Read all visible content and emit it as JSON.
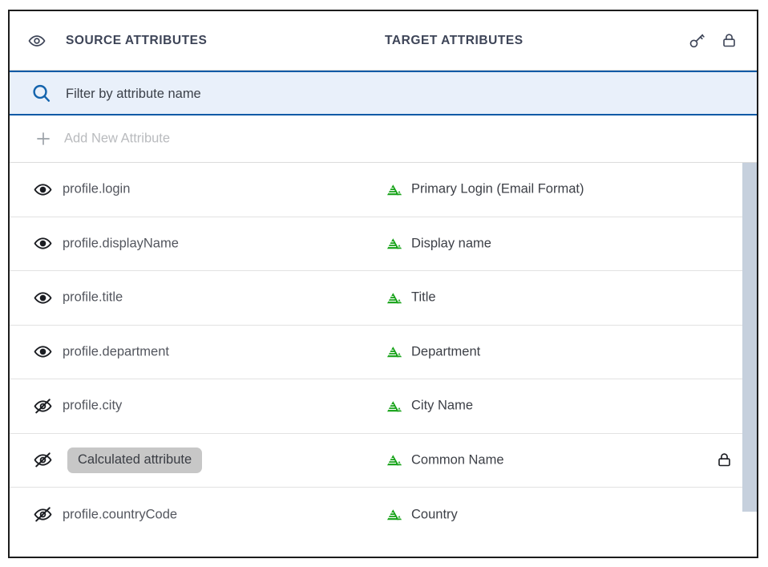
{
  "header": {
    "visibility_icon": "eye-icon",
    "source_column_label": "SOURCE ATTRIBUTES",
    "target_column_label": "TARGET ATTRIBUTES",
    "key_icon": "key-icon",
    "lock_icon": "lock-icon"
  },
  "filter": {
    "icon": "search-icon",
    "value": "",
    "placeholder": "Filter by attribute name"
  },
  "add_row": {
    "icon": "plus-icon",
    "label": "Add New Attribute"
  },
  "rows": [
    {
      "visibility": "visible",
      "visibility_icon": "eye-icon",
      "source": "profile.login",
      "source_is_chip": false,
      "target_icon": "okta-mark-icon",
      "target": "Primary Login (Email Format)",
      "locked": false
    },
    {
      "visibility": "visible",
      "visibility_icon": "eye-icon",
      "source": "profile.displayName",
      "source_is_chip": false,
      "target_icon": "okta-mark-icon",
      "target": "Display name",
      "locked": false
    },
    {
      "visibility": "visible",
      "visibility_icon": "eye-icon",
      "source": "profile.title",
      "source_is_chip": false,
      "target_icon": "okta-mark-icon",
      "target": "Title",
      "locked": false
    },
    {
      "visibility": "visible",
      "visibility_icon": "eye-icon",
      "source": "profile.department",
      "source_is_chip": false,
      "target_icon": "okta-mark-icon",
      "target": "Department",
      "locked": false
    },
    {
      "visibility": "hidden",
      "visibility_icon": "eye-off-icon",
      "source": "profile.city",
      "source_is_chip": false,
      "target_icon": "okta-mark-icon",
      "target": "City Name",
      "locked": false
    },
    {
      "visibility": "hidden",
      "visibility_icon": "eye-off-icon",
      "source": "Calculated attribute",
      "source_is_chip": true,
      "target_icon": "okta-mark-icon",
      "target": "Common Name",
      "locked": true,
      "lock_icon": "lock-icon"
    },
    {
      "visibility": "hidden",
      "visibility_icon": "eye-off-icon",
      "source": "profile.countryCode",
      "source_is_chip": false,
      "target_icon": "okta-mark-icon",
      "target": "Country",
      "locked": false
    }
  ],
  "scrollbar": {
    "orientation": "vertical",
    "thumb_position": "top"
  },
  "colors": {
    "accent_blue": "#0c5aa6",
    "filter_background": "#e9f0fa",
    "target_mark_green": "#18a31a",
    "chip_background": "#c7c7c7",
    "scrollbar_thumb": "#c6d0dd",
    "border": "#1c1c1c"
  }
}
